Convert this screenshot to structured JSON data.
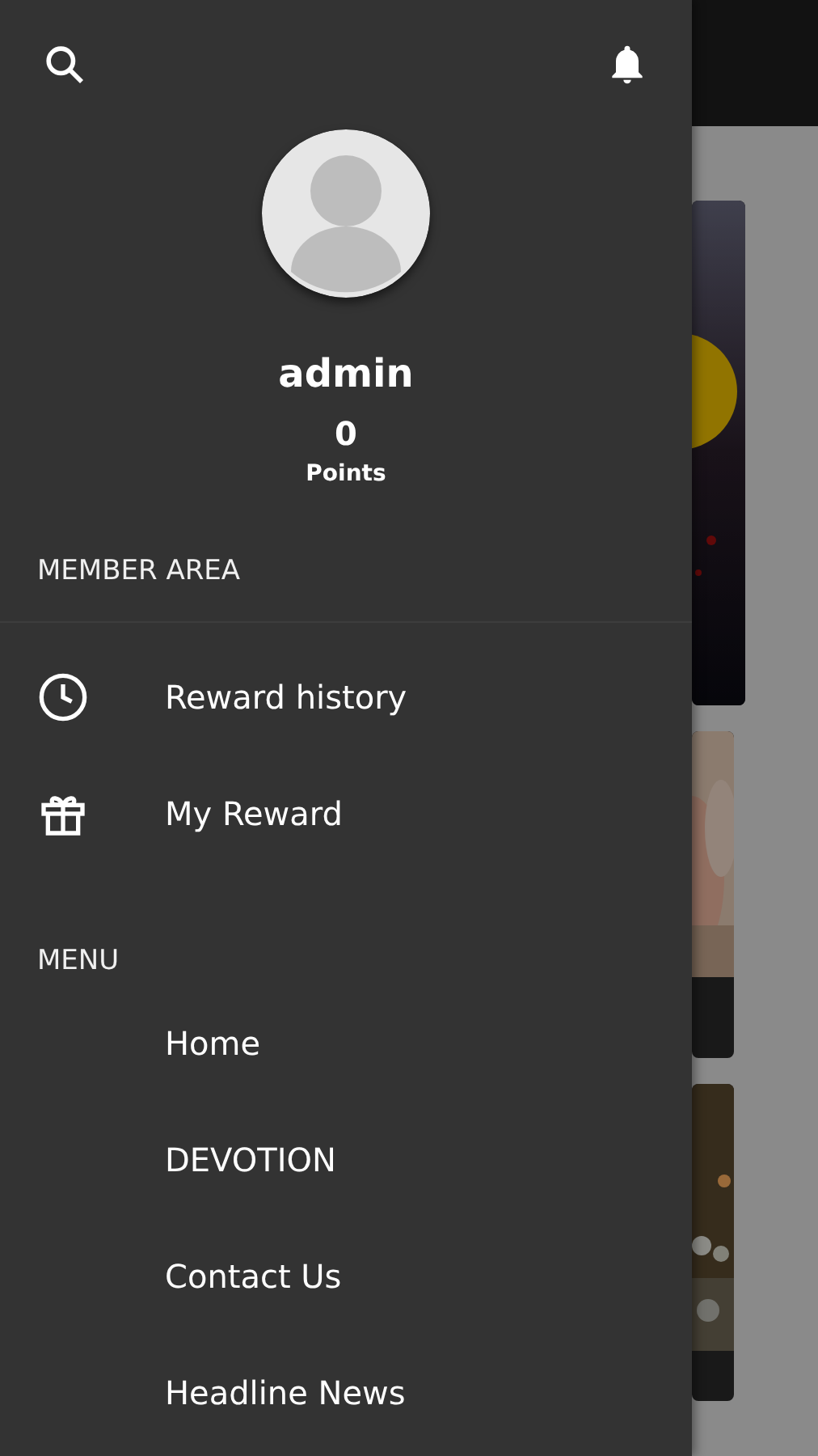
{
  "drawer": {
    "user": {
      "name": "admin",
      "points": "0",
      "points_label": "Points"
    },
    "sections": [
      {
        "kind": "member",
        "title": "MEMBER AREA",
        "items": [
          {
            "label": "Reward history"
          },
          {
            "label": "My Reward"
          }
        ]
      },
      {
        "kind": "menu",
        "title": "MENU",
        "items": [
          {
            "label": "Home"
          },
          {
            "label": "DEVOTION"
          },
          {
            "label": "Contact Us"
          },
          {
            "label": "Headline News"
          }
        ]
      }
    ]
  }
}
